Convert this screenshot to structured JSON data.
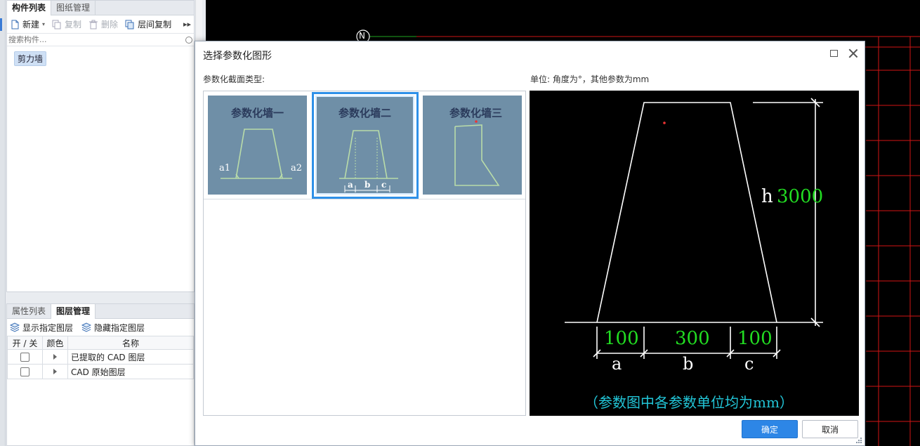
{
  "left_panel": {
    "top_tabs": [
      "构件列表",
      "图纸管理"
    ],
    "toolbar": {
      "new_label": "新建",
      "copy_label": "复制",
      "delete_label": "删除",
      "floor_copy_label": "层间复制",
      "more_label": "▸▸"
    },
    "search_placeholder": "搜索构件...",
    "tree_item": "剪力墙",
    "bottom_tabs": [
      "属性列表",
      "图层管理"
    ],
    "layer_toolbar": {
      "show_label": "显示指定图层",
      "hide_label": "隐藏指定图层"
    },
    "layer_table": {
      "headers": [
        "开 / 关",
        "颜色",
        "名称"
      ],
      "rows": [
        {
          "name": "已提取的 CAD 图层"
        },
        {
          "name": "CAD 原始图层"
        }
      ]
    }
  },
  "cad": {
    "north_label": "N"
  },
  "dialog": {
    "title": "选择参数化图形",
    "section_label": "参数化截面类型:",
    "unit_label": "单位:   角度为°，其他参数为mm",
    "shapes": [
      {
        "title": "参数化墙一",
        "labels": [
          "a1",
          "a2"
        ],
        "selected": false
      },
      {
        "title": "参数化墙二",
        "labels": [
          "a",
          "b",
          "c"
        ],
        "selected": true
      },
      {
        "title": "参数化墙三",
        "labels": [],
        "selected": false
      }
    ],
    "preview": {
      "h_label": "h",
      "h_value": "3000",
      "dims": [
        {
          "value": "100",
          "label": "a"
        },
        {
          "value": "300",
          "label": "b"
        },
        {
          "value": "100",
          "label": "c"
        }
      ],
      "note": "（参数图中各参数单位均为mm）",
      "colors": {
        "value": "#22dd22",
        "note": "#22c6d8",
        "line": "#ffffff"
      }
    },
    "ok_label": "确定",
    "cancel_label": "取消"
  }
}
